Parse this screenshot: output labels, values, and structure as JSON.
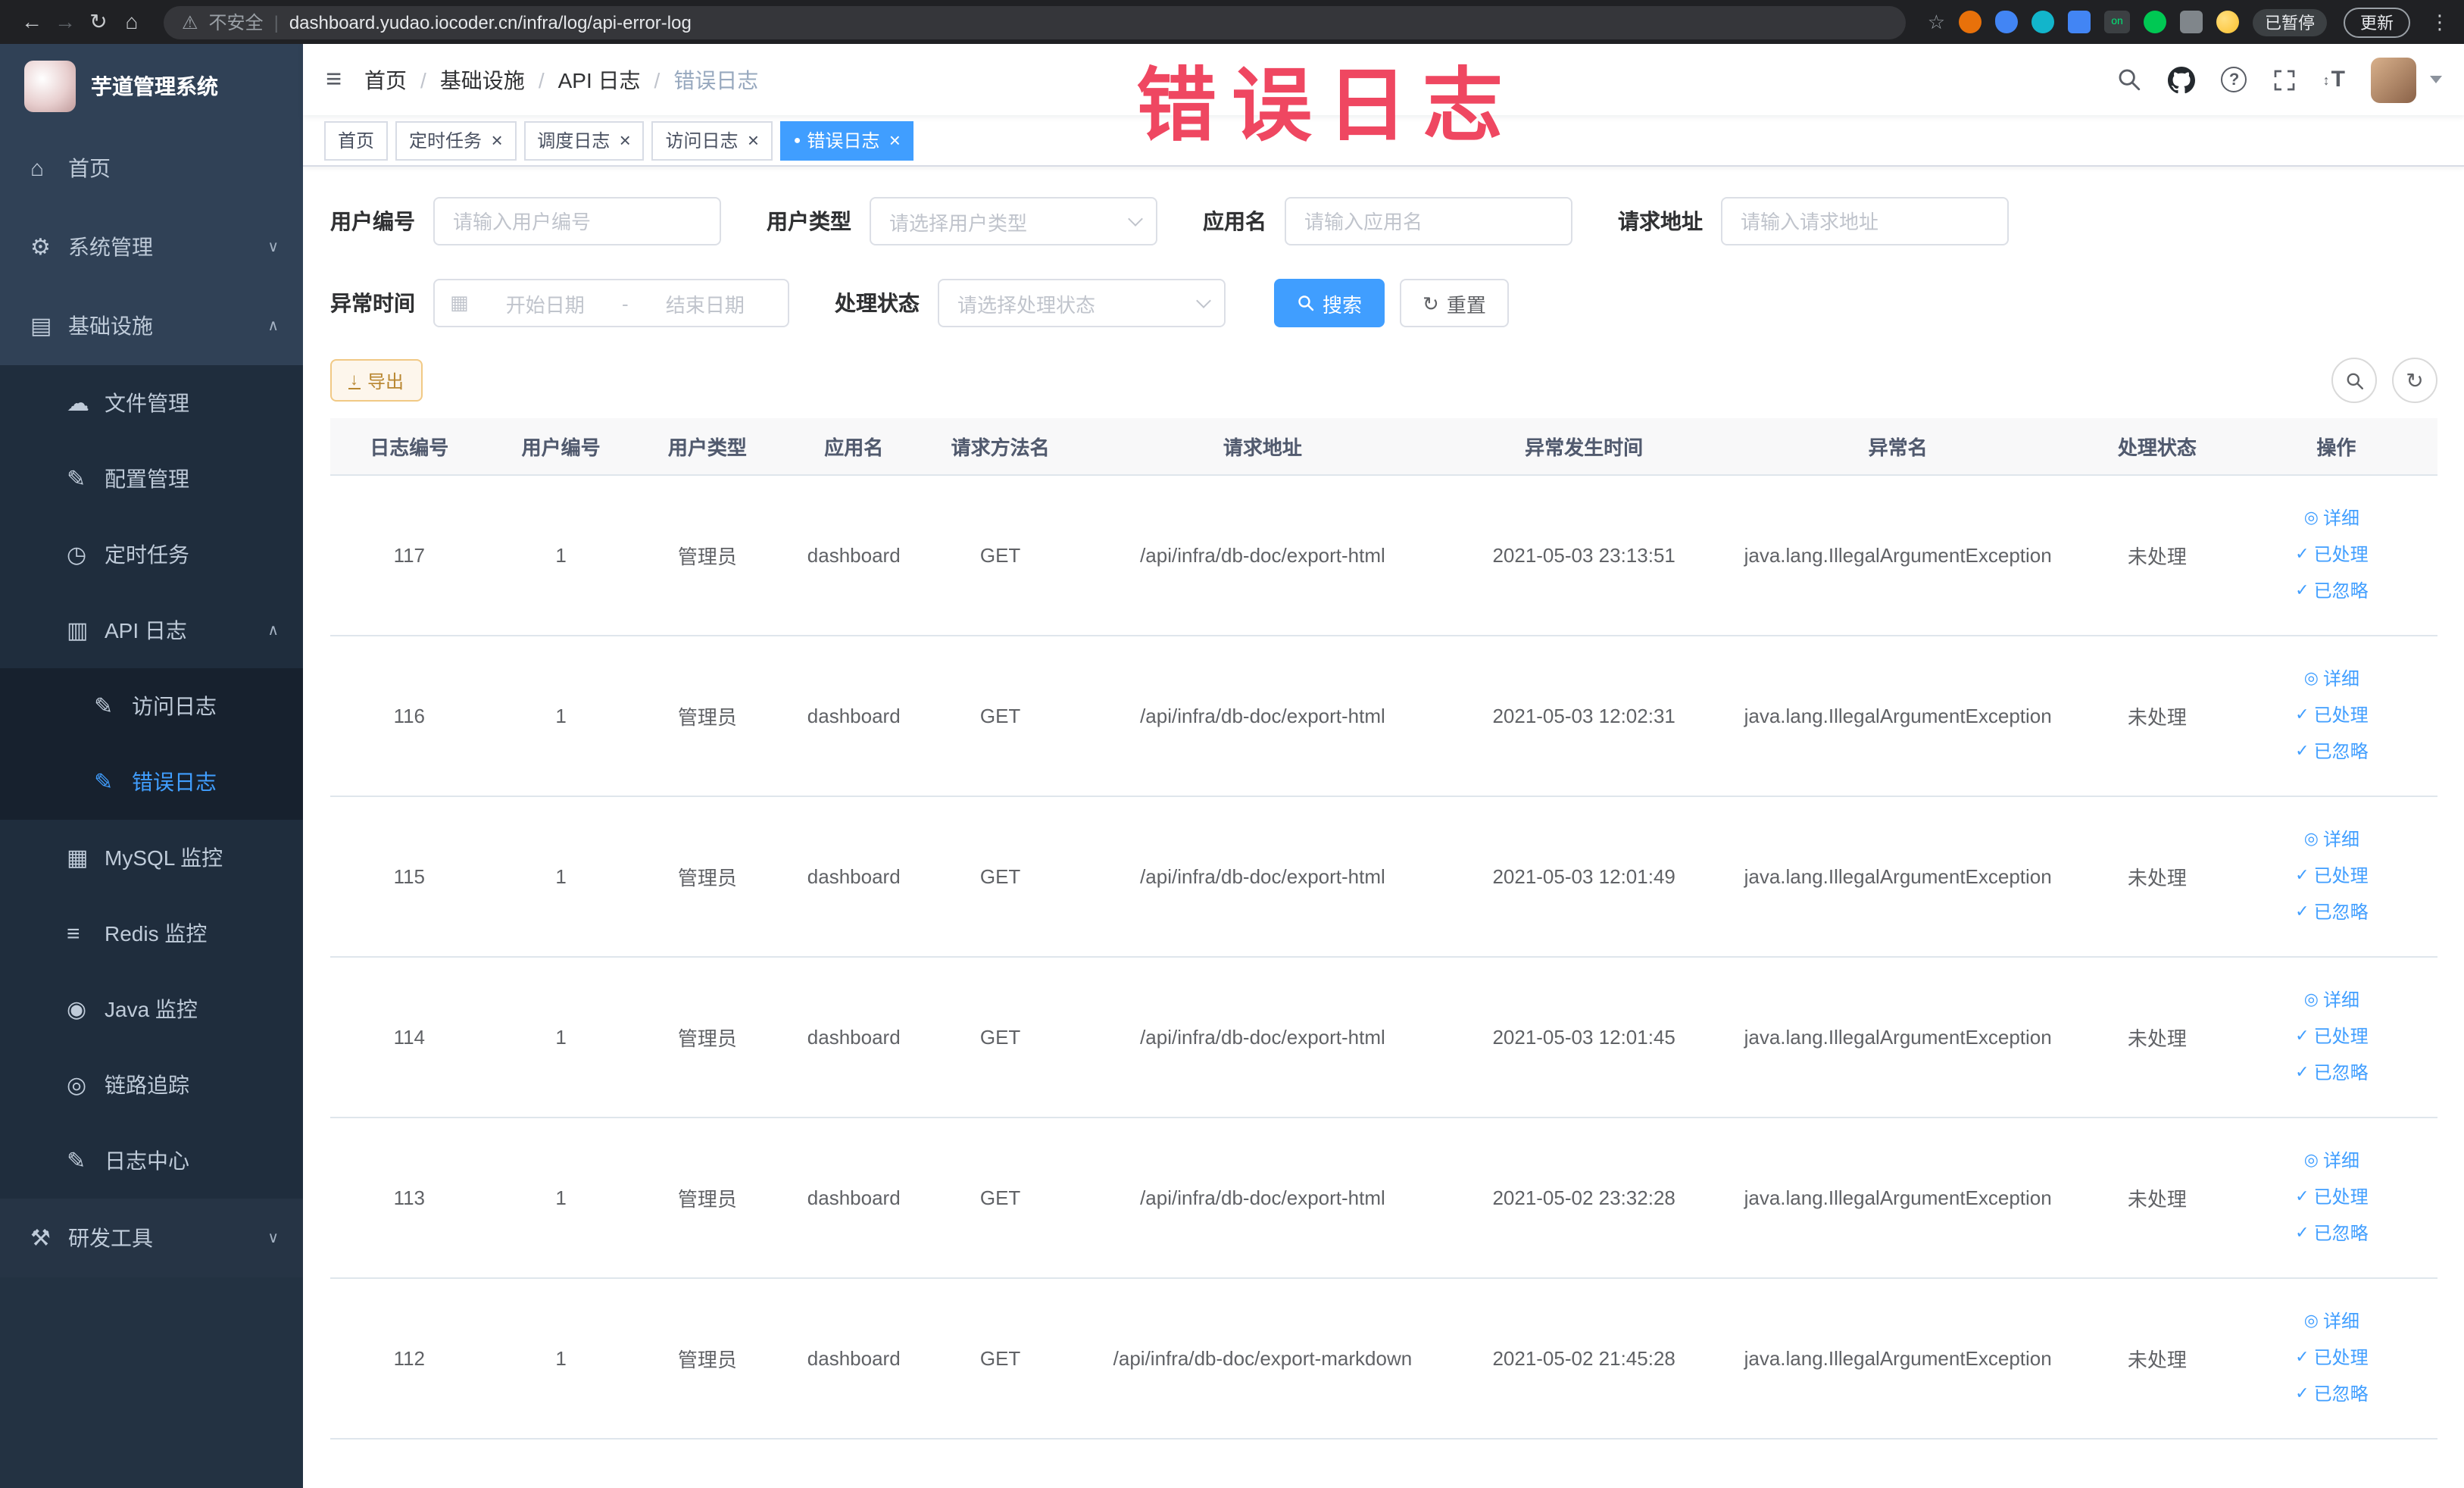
{
  "theme": {
    "primary": "#409eff",
    "watermark": "#ef4761",
    "sidebarBg": "#304156",
    "warning": "#e6a23c"
  },
  "browser": {
    "security_label": "不安全",
    "divider": "|",
    "url": "dashboard.yudao.iocoder.cn/infra/log/api-error-log",
    "extension_badge": "on",
    "paused_label": "已暂停",
    "update_label": "更新"
  },
  "watermark": "错误日志",
  "sidebar": {
    "logo_title": "芋道管理系统",
    "items": [
      {
        "label": "首页",
        "icon": "home",
        "chevron": "",
        "cls": "l1"
      },
      {
        "label": "系统管理",
        "icon": "gear",
        "chevron": "down",
        "cls": "l1"
      },
      {
        "label": "基础设施",
        "icon": "monitor",
        "chevron": "up",
        "cls": "l1 open"
      },
      {
        "label": "文件管理",
        "icon": "cloud",
        "chevron": "",
        "cls": "l2"
      },
      {
        "label": "配置管理",
        "icon": "edit",
        "chevron": "",
        "cls": "l2"
      },
      {
        "label": "定时任务",
        "icon": "task",
        "chevron": "",
        "cls": "l2"
      },
      {
        "label": "API 日志",
        "icon": "doc",
        "chevron": "up",
        "cls": "l2 open"
      },
      {
        "label": "访问日志",
        "icon": "edit",
        "chevron": "",
        "cls": "l3"
      },
      {
        "label": "错误日志",
        "icon": "edit",
        "chevron": "",
        "cls": "l3 active"
      },
      {
        "label": "MySQL 监控",
        "icon": "grid",
        "chevron": "",
        "cls": "l2"
      },
      {
        "label": "Redis 监控",
        "icon": "layers",
        "chevron": "",
        "cls": "l2"
      },
      {
        "label": "Java 监控",
        "icon": "java",
        "chevron": "",
        "cls": "l2"
      },
      {
        "label": "链路追踪",
        "icon": "eye",
        "chevron": "",
        "cls": "l2"
      },
      {
        "label": "日志中心",
        "icon": "edit",
        "chevron": "",
        "cls": "l2"
      },
      {
        "label": "研发工具",
        "icon": "tools",
        "chevron": "down",
        "cls": "l1 alt"
      }
    ]
  },
  "header": {
    "breadcrumb": [
      "首页",
      "基础设施",
      "API 日志",
      "错误日志"
    ],
    "breadcrumb_separator": "/"
  },
  "tabs": [
    {
      "label": "首页",
      "dot": "",
      "close": "",
      "cls": ""
    },
    {
      "label": "定时任务",
      "dot": "",
      "close": "×",
      "cls": ""
    },
    {
      "label": "调度日志",
      "dot": "",
      "close": "×",
      "cls": ""
    },
    {
      "label": "访问日志",
      "dot": "",
      "close": "×",
      "cls": ""
    },
    {
      "label": "错误日志",
      "dot": "●",
      "close": "×",
      "cls": "active"
    }
  ],
  "filters": {
    "user_id_label": "用户编号",
    "user_id_placeholder": "请输入用户编号",
    "user_type_label": "用户类型",
    "user_type_placeholder": "请选择用户类型",
    "app_name_label": "应用名",
    "app_name_placeholder": "请输入应用名",
    "request_url_label": "请求地址",
    "request_url_placeholder": "请输入请求地址",
    "exception_time_label": "异常时间",
    "date_start_placeholder": "开始日期",
    "date_separator": "-",
    "date_end_placeholder": "结束日期",
    "process_status_label": "处理状态",
    "process_status_placeholder": "请选择处理状态",
    "search_label": "搜索",
    "reset_label": "重置"
  },
  "toolbar": {
    "export_label": "导出"
  },
  "table": {
    "headers": [
      "日志编号",
      "用户编号",
      "用户类型",
      "应用名",
      "请求方法名",
      "请求地址",
      "异常发生时间",
      "异常名",
      "处理状态",
      "操作"
    ],
    "action_labels": {
      "detail": "详细",
      "processed": "已处理",
      "ignored": "已忽略"
    },
    "action_icons": {
      "detail": "eye",
      "processed": "check",
      "ignored": "check"
    },
    "rows": [
      {
        "id": "117",
        "user_id": "1",
        "user_type": "管理员",
        "app": "dashboard",
        "method": "GET",
        "url": "/api/infra/db-doc/export-html",
        "time": "2021-05-03 23:13:51",
        "exception": "java.lang.IllegalArgumentException",
        "status": "未处理"
      },
      {
        "id": "116",
        "user_id": "1",
        "user_type": "管理员",
        "app": "dashboard",
        "method": "GET",
        "url": "/api/infra/db-doc/export-html",
        "time": "2021-05-03 12:02:31",
        "exception": "java.lang.IllegalArgumentException",
        "status": "未处理"
      },
      {
        "id": "115",
        "user_id": "1",
        "user_type": "管理员",
        "app": "dashboard",
        "method": "GET",
        "url": "/api/infra/db-doc/export-html",
        "time": "2021-05-03 12:01:49",
        "exception": "java.lang.IllegalArgumentException",
        "status": "未处理"
      },
      {
        "id": "114",
        "user_id": "1",
        "user_type": "管理员",
        "app": "dashboard",
        "method": "GET",
        "url": "/api/infra/db-doc/export-html",
        "time": "2021-05-03 12:01:45",
        "exception": "java.lang.IllegalArgumentException",
        "status": "未处理"
      },
      {
        "id": "113",
        "user_id": "1",
        "user_type": "管理员",
        "app": "dashboard",
        "method": "GET",
        "url": "/api/infra/db-doc/export-html",
        "time": "2021-05-02 23:32:28",
        "exception": "java.lang.IllegalArgumentException",
        "status": "未处理"
      },
      {
        "id": "112",
        "user_id": "1",
        "user_type": "管理员",
        "app": "dashboard",
        "method": "GET",
        "url": "/api/infra/db-doc/export-markdown",
        "time": "2021-05-02 21:45:28",
        "exception": "java.lang.IllegalArgumentException",
        "status": "未处理"
      }
    ]
  }
}
